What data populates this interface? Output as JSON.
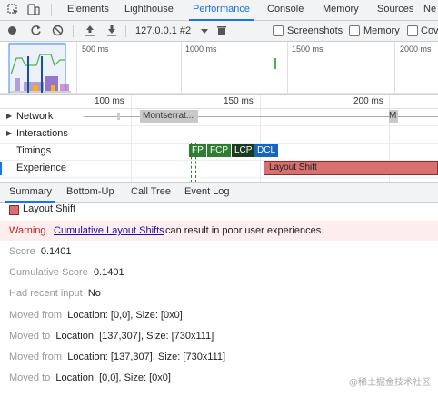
{
  "tabbar": {
    "tabs": [
      "Elements",
      "Lighthouse",
      "Performance",
      "Console",
      "Memory",
      "Sources",
      "Ne"
    ],
    "active": "Performance"
  },
  "toolbar": {
    "profile": "127.0.0.1 #2",
    "screenshots_label": "Screenshots",
    "memory_label": "Memory",
    "coverage_label": "Cov"
  },
  "overview": {
    "ticks": [
      "500 ms",
      "1000 ms",
      "1500 ms",
      "2000 ms"
    ]
  },
  "ruler": {
    "ticks": [
      "100 ms",
      "150 ms",
      "200 ms"
    ]
  },
  "tracks": {
    "network": "Network",
    "network_bar": "Montserrat...",
    "network_bar2": "M",
    "interactions": "Interactions",
    "timings": "Timings",
    "timing_marks": [
      "FP",
      "FCP",
      "LCP",
      "DCL"
    ],
    "experience": "Experience",
    "experience_bar": "Layout Shift"
  },
  "subtabs": {
    "tabs": [
      "Summary",
      "Bottom-Up",
      "Call Tree",
      "Event Log"
    ],
    "active": "Summary"
  },
  "summary": {
    "title": "Layout Shift",
    "warning_label": "Warning",
    "warning_link": "Cumulative Layout Shifts",
    "warning_text": "can result in poor user experiences.",
    "score_label": "Score",
    "score": "0.1401",
    "cumulative_label": "Cumulative Score",
    "cumulative": "0.1401",
    "recent_input_label": "Had recent input",
    "recent_input": "No",
    "moved_from_label": "Moved from",
    "moved_from_1": "Location: [0,0], Size: [0x0]",
    "moved_to_label": "Moved to",
    "moved_to_1": "Location: [137,307], Size: [730x111]",
    "moved_from_2": "Location: [137,307], Size: [730x111]",
    "moved_to_2": "Location: [0,0], Size: [0x0]"
  },
  "watermark": "@稀土掘金技术社区",
  "colors": {
    "accent": "#1a73e8",
    "layout_shift": "#d87070",
    "fp": "#2e7d32",
    "lcp": "#1b3a1f",
    "dcl": "#1565c0",
    "warning_bg": "#fdeded"
  }
}
